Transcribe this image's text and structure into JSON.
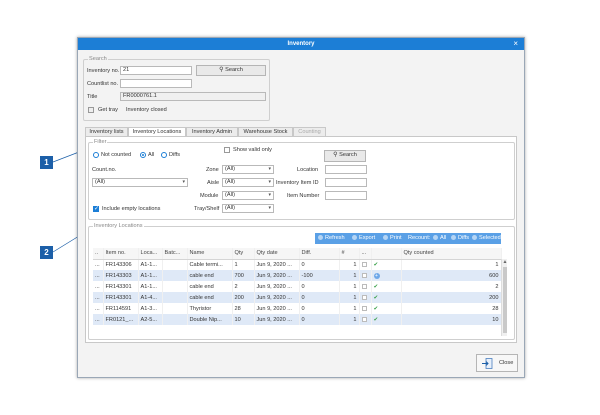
{
  "window": {
    "title": "Inventory",
    "close_glyph": "×"
  },
  "search": {
    "group_title": "Search",
    "inventory_no_label": "Inventory no.",
    "inventory_no_value": "21",
    "search_button": "Search",
    "countlist_label": "Countlist no.",
    "countlist_value": "",
    "title_label": "Title",
    "title_value": "FR0000761.1",
    "get_tray_label": "Get tray",
    "status_text": "Inventory closed"
  },
  "tabs": [
    {
      "label": "Inventory lists"
    },
    {
      "label": "Inventory Locations"
    },
    {
      "label": "Inventory Admin"
    },
    {
      "label": "Warehouse Stock"
    },
    {
      "label": "Counting"
    }
  ],
  "filter": {
    "group_title": "Filter",
    "radio_not_counted": "Not counted",
    "radio_all": "All",
    "radio_diffs": "Diffs",
    "show_valid_only": "Show valid only",
    "search_button": "Search",
    "count_no_label": "Count.no.",
    "count_no_value": "(All)",
    "zone_label": "Zone",
    "zone_value": "(All)",
    "aisle_label": "Aisle",
    "aisle_value": "(All)",
    "module_label": "Module",
    "module_value": "(All)",
    "tray_label": "Tray/Shelf",
    "tray_value": "(All)",
    "location_label": "Location",
    "inventory_item_id_label": "Inventory Item ID",
    "item_number_label": "Item Number",
    "include_empty_label": "Include empty locations"
  },
  "locations": {
    "group_title": "Inventory Locations",
    "toolbar": [
      "Refresh",
      "Export",
      "Print",
      "Recount:",
      "All",
      "Diffs",
      "Selected"
    ],
    "columns": [
      "..",
      "Item no.",
      "Loca...",
      "Batc...",
      "Name",
      "Qty",
      "Qty date",
      "Diff.",
      "#",
      "...",
      "",
      "Qty counted"
    ],
    "rows": [
      {
        "menu": "...",
        "item_no": "FR143306",
        "loc": "A1-1...",
        "batch": "",
        "name": "Cable termi...",
        "qty": "1",
        "qty_date": "Jun 9, 2020 ...",
        "diff": "0",
        "count": "1",
        "status": "ok",
        "qty_counted": "1"
      },
      {
        "menu": "...",
        "item_no": "FR143303",
        "loc": "A1-1...",
        "batch": "",
        "name": "cable end",
        "qty": "700",
        "qty_date": "Jun 9, 2020 ...",
        "diff": "-100",
        "count": "1",
        "status": "info",
        "qty_counted": "600"
      },
      {
        "menu": "...",
        "item_no": "FR143301",
        "loc": "A1-1...",
        "batch": "",
        "name": "cable end",
        "qty": "2",
        "qty_date": "Jun 9, 2020 ...",
        "diff": "0",
        "count": "1",
        "status": "ok",
        "qty_counted": "2"
      },
      {
        "menu": "...",
        "item_no": "FR143301",
        "loc": "A1-4...",
        "batch": "",
        "name": "cable end",
        "qty": "200",
        "qty_date": "Jun 9, 2020 ...",
        "diff": "0",
        "count": "1",
        "status": "ok",
        "qty_counted": "200"
      },
      {
        "menu": "...",
        "item_no": "FR114591",
        "loc": "A1-3...",
        "batch": "",
        "name": "Thyristor",
        "qty": "28",
        "qty_date": "Jun 9, 2020 ...",
        "diff": "0",
        "count": "1",
        "status": "ok",
        "qty_counted": "28"
      },
      {
        "menu": "...",
        "item_no": "FR0121_...",
        "loc": "A2-5...",
        "batch": "",
        "name": "Double Nip...",
        "qty": "10",
        "qty_date": "Jun 9, 2020 ...",
        "diff": "0",
        "count": "1",
        "status": "ok",
        "qty_counted": "10"
      }
    ]
  },
  "footer": {
    "close_button": "Close"
  },
  "markers": [
    "1",
    "2"
  ],
  "colors": {
    "accent": "#1c7ed6",
    "toolbar": "#5aa0e6",
    "row_alt": "#dfe9f7",
    "ok": "#3aa04a"
  }
}
